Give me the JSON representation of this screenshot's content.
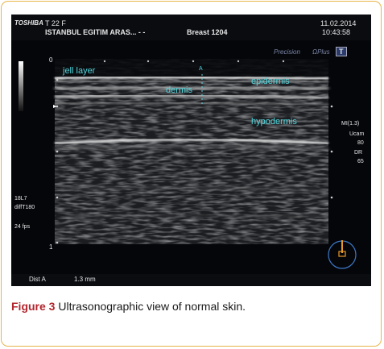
{
  "header": {
    "brand": "TOSHIBA",
    "mode_line": "T  22  F",
    "institution": "ISTANBUL EGITIM ARAS...  -  -",
    "exam": "Breast 1204",
    "date": "11.02.2014",
    "time": "10:43:58"
  },
  "top_right": {
    "precision": "Precision",
    "aplus": "ΩPlus",
    "badge": "T"
  },
  "depth_scale": {
    "top": "0",
    "bottom": "1"
  },
  "labels": {
    "jell_layer": "jell layer",
    "dermis": "dermis",
    "epidermis": "epidermis",
    "hypodermis": "hypodermis",
    "marker": "A"
  },
  "right_params": {
    "mi": "MI(1.3)",
    "ucam": "Ucam",
    "gain": "80",
    "dr_label": "DR",
    "dr_value": "65"
  },
  "left_params": {
    "probe": "18L7",
    "mode": "diffT180",
    "fps": "24 fps"
  },
  "bottom": {
    "dist_label": "Dist A",
    "dist_value": "1.3 mm"
  },
  "caption": {
    "label": "Figure 3",
    "text": " Ultrasonographic view of normal skin."
  },
  "colors": {
    "frame": "#e8b54a",
    "figure_label": "#b2252d",
    "annotation": "#4fd6dc"
  }
}
